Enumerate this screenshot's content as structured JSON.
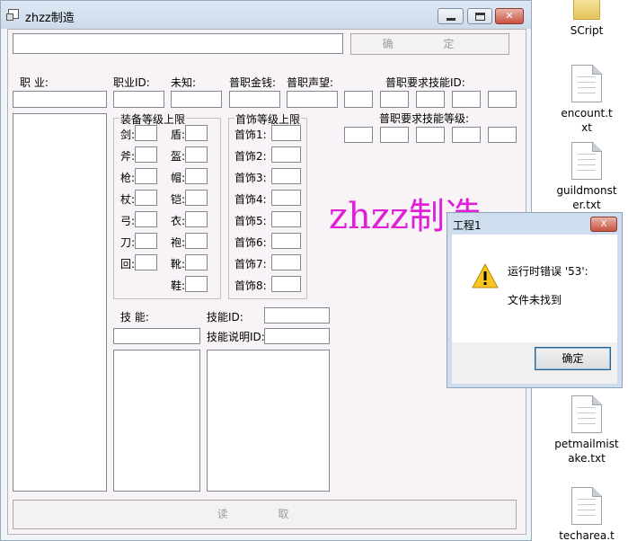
{
  "window": {
    "title": "zhzz制造",
    "top_input_value": "",
    "confirm_label": "确 定",
    "read_label": "读 取"
  },
  "labels": {
    "job": "职 业:",
    "job_id": "职业ID:",
    "unknown": "未知:",
    "money": "普职金钱:",
    "fame": "普职声望:",
    "req_skill_id": "普职要求技能ID:",
    "req_skill_level": "普职要求技能等级:",
    "equip_group": "装备等级上限",
    "jewel_group": "首饰等级上限",
    "skill": "技 能:",
    "skill_id": "技能ID:",
    "skill_desc": "技能说明ID:"
  },
  "equip_left": [
    "剑:",
    "斧:",
    "枪:",
    "杖:",
    "弓:",
    "刀:",
    "回:"
  ],
  "equip_right": [
    "盾:",
    "盔:",
    "帽:",
    "铠:",
    "衣:",
    "袍:",
    "靴:",
    "鞋:"
  ],
  "jewels": [
    "首饰1:",
    "首饰2:",
    "首饰3:",
    "首饰4:",
    "首饰5:",
    "首饰6:",
    "首饰7:",
    "首饰8:"
  ],
  "watermark": "zhzz制造",
  "dialog": {
    "title": "工程1",
    "message": "运行时错误 '53':",
    "detail": "文件未找到",
    "ok_label": "确定",
    "close_label": "X"
  },
  "desktop_files": [
    {
      "label": "SCript"
    },
    {
      "label": "encount.txt"
    },
    {
      "label": "guildmonster.txt"
    },
    {
      "label": "petmailmistake.txt"
    },
    {
      "label": "techarea.t"
    }
  ],
  "colors": {
    "watermark": "#e020d8",
    "client_bg": "#f7f3f6"
  }
}
